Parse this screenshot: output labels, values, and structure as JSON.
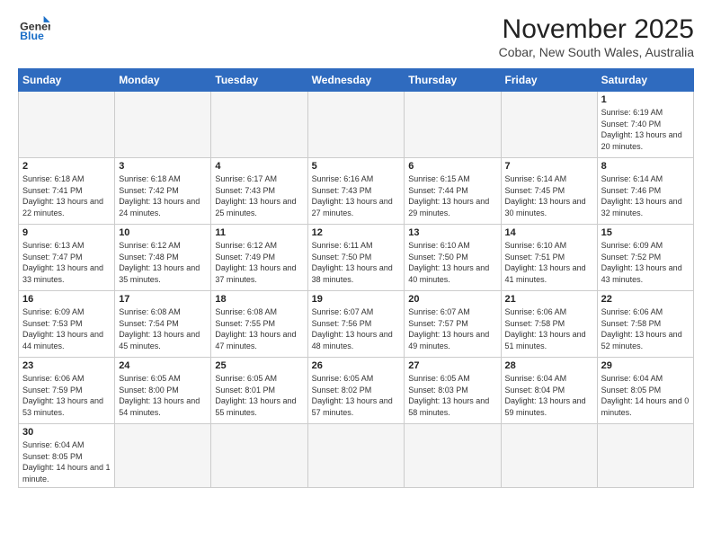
{
  "header": {
    "logo_line1": "General",
    "logo_line2": "Blue",
    "month_title": "November 2025",
    "location": "Cobar, New South Wales, Australia"
  },
  "days_of_week": [
    "Sunday",
    "Monday",
    "Tuesday",
    "Wednesday",
    "Thursday",
    "Friday",
    "Saturday"
  ],
  "weeks": [
    [
      {
        "day": "",
        "info": ""
      },
      {
        "day": "",
        "info": ""
      },
      {
        "day": "",
        "info": ""
      },
      {
        "day": "",
        "info": ""
      },
      {
        "day": "",
        "info": ""
      },
      {
        "day": "",
        "info": ""
      },
      {
        "day": "1",
        "info": "Sunrise: 6:19 AM\nSunset: 7:40 PM\nDaylight: 13 hours\nand 20 minutes."
      }
    ],
    [
      {
        "day": "2",
        "info": "Sunrise: 6:18 AM\nSunset: 7:41 PM\nDaylight: 13 hours\nand 22 minutes."
      },
      {
        "day": "3",
        "info": "Sunrise: 6:18 AM\nSunset: 7:42 PM\nDaylight: 13 hours\nand 24 minutes."
      },
      {
        "day": "4",
        "info": "Sunrise: 6:17 AM\nSunset: 7:43 PM\nDaylight: 13 hours\nand 25 minutes."
      },
      {
        "day": "5",
        "info": "Sunrise: 6:16 AM\nSunset: 7:43 PM\nDaylight: 13 hours\nand 27 minutes."
      },
      {
        "day": "6",
        "info": "Sunrise: 6:15 AM\nSunset: 7:44 PM\nDaylight: 13 hours\nand 29 minutes."
      },
      {
        "day": "7",
        "info": "Sunrise: 6:14 AM\nSunset: 7:45 PM\nDaylight: 13 hours\nand 30 minutes."
      },
      {
        "day": "8",
        "info": "Sunrise: 6:14 AM\nSunset: 7:46 PM\nDaylight: 13 hours\nand 32 minutes."
      }
    ],
    [
      {
        "day": "9",
        "info": "Sunrise: 6:13 AM\nSunset: 7:47 PM\nDaylight: 13 hours\nand 33 minutes."
      },
      {
        "day": "10",
        "info": "Sunrise: 6:12 AM\nSunset: 7:48 PM\nDaylight: 13 hours\nand 35 minutes."
      },
      {
        "day": "11",
        "info": "Sunrise: 6:12 AM\nSunset: 7:49 PM\nDaylight: 13 hours\nand 37 minutes."
      },
      {
        "day": "12",
        "info": "Sunrise: 6:11 AM\nSunset: 7:50 PM\nDaylight: 13 hours\nand 38 minutes."
      },
      {
        "day": "13",
        "info": "Sunrise: 6:10 AM\nSunset: 7:50 PM\nDaylight: 13 hours\nand 40 minutes."
      },
      {
        "day": "14",
        "info": "Sunrise: 6:10 AM\nSunset: 7:51 PM\nDaylight: 13 hours\nand 41 minutes."
      },
      {
        "day": "15",
        "info": "Sunrise: 6:09 AM\nSunset: 7:52 PM\nDaylight: 13 hours\nand 43 minutes."
      }
    ],
    [
      {
        "day": "16",
        "info": "Sunrise: 6:09 AM\nSunset: 7:53 PM\nDaylight: 13 hours\nand 44 minutes."
      },
      {
        "day": "17",
        "info": "Sunrise: 6:08 AM\nSunset: 7:54 PM\nDaylight: 13 hours\nand 45 minutes."
      },
      {
        "day": "18",
        "info": "Sunrise: 6:08 AM\nSunset: 7:55 PM\nDaylight: 13 hours\nand 47 minutes."
      },
      {
        "day": "19",
        "info": "Sunrise: 6:07 AM\nSunset: 7:56 PM\nDaylight: 13 hours\nand 48 minutes."
      },
      {
        "day": "20",
        "info": "Sunrise: 6:07 AM\nSunset: 7:57 PM\nDaylight: 13 hours\nand 49 minutes."
      },
      {
        "day": "21",
        "info": "Sunrise: 6:06 AM\nSunset: 7:58 PM\nDaylight: 13 hours\nand 51 minutes."
      },
      {
        "day": "22",
        "info": "Sunrise: 6:06 AM\nSunset: 7:58 PM\nDaylight: 13 hours\nand 52 minutes."
      }
    ],
    [
      {
        "day": "23",
        "info": "Sunrise: 6:06 AM\nSunset: 7:59 PM\nDaylight: 13 hours\nand 53 minutes."
      },
      {
        "day": "24",
        "info": "Sunrise: 6:05 AM\nSunset: 8:00 PM\nDaylight: 13 hours\nand 54 minutes."
      },
      {
        "day": "25",
        "info": "Sunrise: 6:05 AM\nSunset: 8:01 PM\nDaylight: 13 hours\nand 55 minutes."
      },
      {
        "day": "26",
        "info": "Sunrise: 6:05 AM\nSunset: 8:02 PM\nDaylight: 13 hours\nand 57 minutes."
      },
      {
        "day": "27",
        "info": "Sunrise: 6:05 AM\nSunset: 8:03 PM\nDaylight: 13 hours\nand 58 minutes."
      },
      {
        "day": "28",
        "info": "Sunrise: 6:04 AM\nSunset: 8:04 PM\nDaylight: 13 hours\nand 59 minutes."
      },
      {
        "day": "29",
        "info": "Sunrise: 6:04 AM\nSunset: 8:05 PM\nDaylight: 14 hours\nand 0 minutes."
      }
    ],
    [
      {
        "day": "30",
        "info": "Sunrise: 6:04 AM\nSunset: 8:05 PM\nDaylight: 14 hours\nand 1 minute."
      },
      {
        "day": "",
        "info": ""
      },
      {
        "day": "",
        "info": ""
      },
      {
        "day": "",
        "info": ""
      },
      {
        "day": "",
        "info": ""
      },
      {
        "day": "",
        "info": ""
      },
      {
        "day": "",
        "info": ""
      }
    ]
  ]
}
